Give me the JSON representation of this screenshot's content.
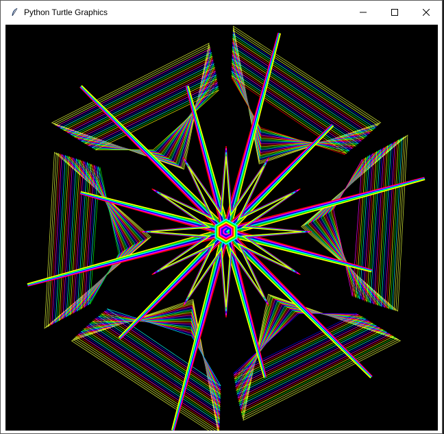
{
  "window": {
    "title": "Python Turtle Graphics",
    "icon": "feather-icon",
    "controls": [
      "minimize-icon",
      "maximize-icon",
      "close-icon"
    ]
  },
  "canvas": {
    "background": "#000000",
    "palette": [
      "#ff0000",
      "#ff00ff",
      "#0000ff",
      "#00ffff",
      "#00ff00",
      "#ffff00"
    ]
  }
}
